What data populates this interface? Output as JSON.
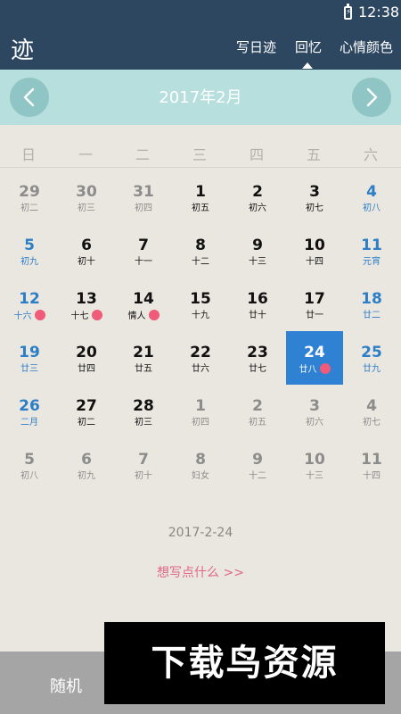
{
  "status_bar": {
    "time": "12:38",
    "battery_icon": "battery-charging-icon"
  },
  "app_bar": {
    "logo": "迹",
    "tabs": [
      {
        "label": "写日迹",
        "active": false
      },
      {
        "label": "回忆",
        "active": true
      },
      {
        "label": "心情颜色",
        "active": false
      }
    ]
  },
  "month_bar": {
    "title": "2017年2月",
    "prev_icon": "chevron-left-icon",
    "next_icon": "chevron-right-icon"
  },
  "weekdays": [
    "日",
    "一",
    "二",
    "三",
    "四",
    "五",
    "六"
  ],
  "weeks": [
    [
      {
        "day": "29",
        "lunar": "初二",
        "state": "other"
      },
      {
        "day": "30",
        "lunar": "初三",
        "state": "other"
      },
      {
        "day": "31",
        "lunar": "初四",
        "state": "other"
      },
      {
        "day": "1",
        "lunar": "初五",
        "state": "cur"
      },
      {
        "day": "2",
        "lunar": "初六",
        "state": "cur"
      },
      {
        "day": "3",
        "lunar": "初七",
        "state": "cur"
      },
      {
        "day": "4",
        "lunar": "初八",
        "state": "weekend"
      }
    ],
    [
      {
        "day": "5",
        "lunar": "初九",
        "state": "weekend"
      },
      {
        "day": "6",
        "lunar": "初十",
        "state": "cur"
      },
      {
        "day": "7",
        "lunar": "十一",
        "state": "cur"
      },
      {
        "day": "8",
        "lunar": "十二",
        "state": "cur"
      },
      {
        "day": "9",
        "lunar": "十三",
        "state": "cur"
      },
      {
        "day": "10",
        "lunar": "十四",
        "state": "cur"
      },
      {
        "day": "11",
        "lunar": "元宵",
        "state": "weekend"
      }
    ],
    [
      {
        "day": "12",
        "lunar": "十六",
        "state": "weekend",
        "mood": true
      },
      {
        "day": "13",
        "lunar": "十七",
        "state": "cur",
        "mood": true
      },
      {
        "day": "14",
        "lunar": "情人",
        "state": "cur",
        "mood": true
      },
      {
        "day": "15",
        "lunar": "十九",
        "state": "cur"
      },
      {
        "day": "16",
        "lunar": "廿十",
        "state": "cur"
      },
      {
        "day": "17",
        "lunar": "廿一",
        "state": "cur"
      },
      {
        "day": "18",
        "lunar": "廿二",
        "state": "weekend"
      }
    ],
    [
      {
        "day": "19",
        "lunar": "廿三",
        "state": "weekend"
      },
      {
        "day": "20",
        "lunar": "廿四",
        "state": "cur"
      },
      {
        "day": "21",
        "lunar": "廿五",
        "state": "cur"
      },
      {
        "day": "22",
        "lunar": "廿六",
        "state": "cur"
      },
      {
        "day": "23",
        "lunar": "廿七",
        "state": "cur"
      },
      {
        "day": "24",
        "lunar": "廿八",
        "state": "selected",
        "mood": true
      },
      {
        "day": "25",
        "lunar": "廿九",
        "state": "weekend"
      }
    ],
    [
      {
        "day": "26",
        "lunar": "二月",
        "state": "weekend"
      },
      {
        "day": "27",
        "lunar": "初二",
        "state": "cur"
      },
      {
        "day": "28",
        "lunar": "初三",
        "state": "cur"
      },
      {
        "day": "1",
        "lunar": "初四",
        "state": "other"
      },
      {
        "day": "2",
        "lunar": "初五",
        "state": "other"
      },
      {
        "day": "3",
        "lunar": "初六",
        "state": "other"
      },
      {
        "day": "4",
        "lunar": "初七",
        "state": "other"
      }
    ],
    [
      {
        "day": "5",
        "lunar": "初八",
        "state": "other"
      },
      {
        "day": "6",
        "lunar": "初九",
        "state": "other"
      },
      {
        "day": "7",
        "lunar": "初十",
        "state": "other"
      },
      {
        "day": "8",
        "lunar": "妇女",
        "state": "other"
      },
      {
        "day": "9",
        "lunar": "十二",
        "state": "other"
      },
      {
        "day": "10",
        "lunar": "十三",
        "state": "other"
      },
      {
        "day": "11",
        "lunar": "十四",
        "state": "other"
      }
    ]
  ],
  "selected_date": "2017-2-24",
  "write_prompt": "想写点什么 >>",
  "bottom_bar": {
    "random_label": "随机"
  },
  "watermark": {
    "text": "下载鸟资源"
  },
  "colors": {
    "header": "#2e4760",
    "month_bar": "#b7dfde",
    "nav_button": "#8fc5c4",
    "selected": "#2f81d4",
    "weekend_text": "#2c7ec6",
    "mood_dot": "#ef5b78",
    "write_link": "#e06786",
    "bottom_bar": "#a5a5a5"
  }
}
